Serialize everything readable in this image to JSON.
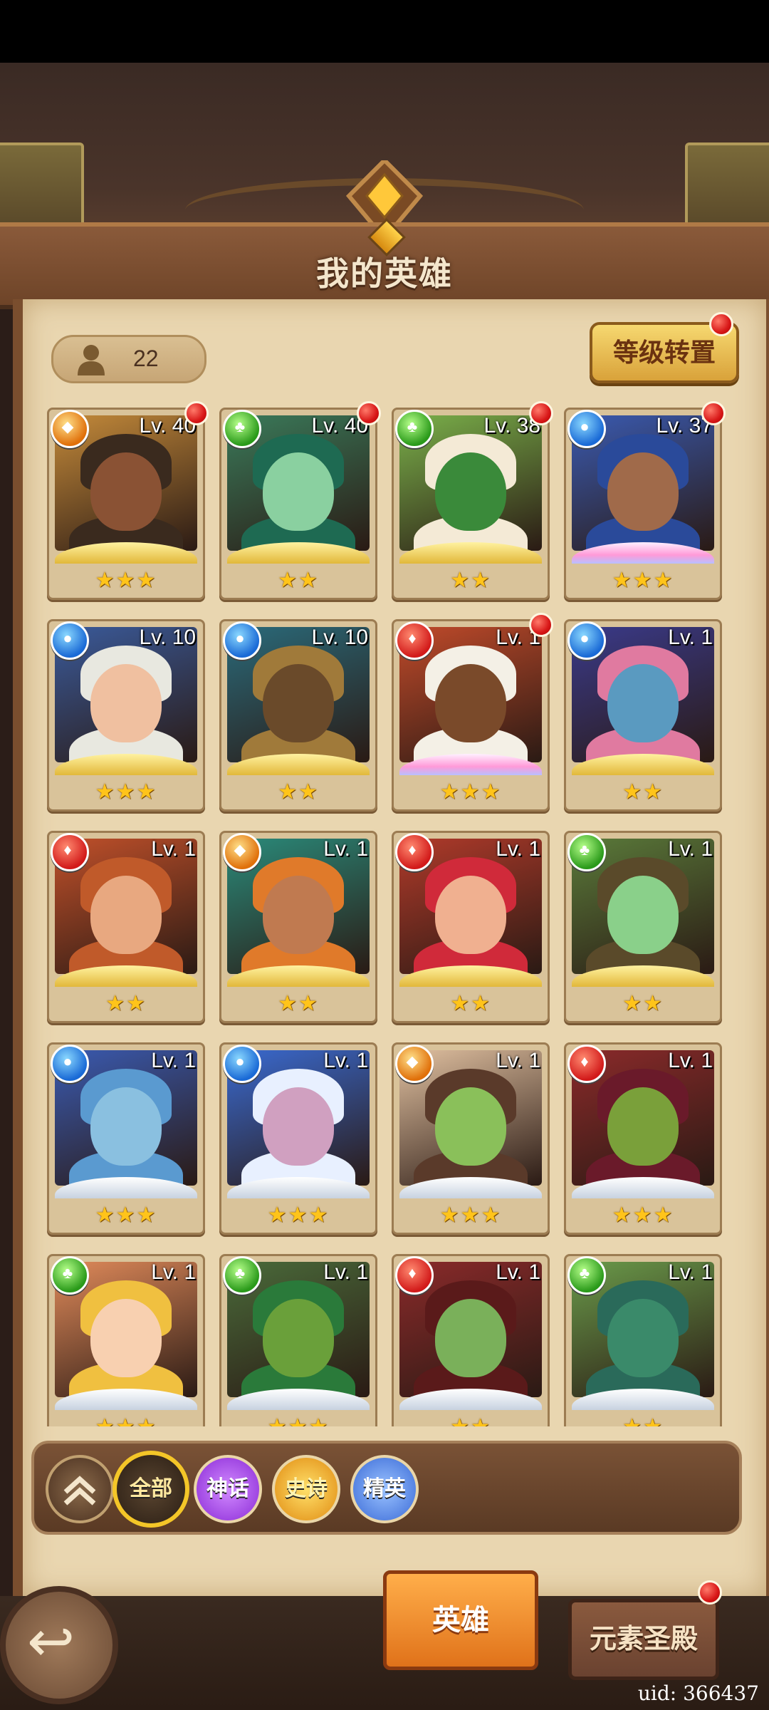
{
  "header": {
    "title": "我的英雄"
  },
  "hero_count": "22",
  "level_transfer_label": "等级转置",
  "filters": {
    "all": "全部",
    "mythic": "神话",
    "epic": "史诗",
    "elite": "精英"
  },
  "bottom_tabs": {
    "heroes": "英雄",
    "element_temple": "元素圣殿"
  },
  "uid": "uid: 366437",
  "heroes": [
    {
      "level": "Lv. 40",
      "element": "light",
      "stars": "★★★",
      "frame": "gold",
      "skin": "#8a5234",
      "hair": "#3a2a1e",
      "bg": "#c48a3a",
      "dot": true
    },
    {
      "level": "Lv. 40",
      "element": "nature",
      "stars": "★★",
      "frame": "gold",
      "skin": "#8ad0a0",
      "hair": "#1e6a52",
      "bg": "#3a7a5a",
      "dot": true
    },
    {
      "level": "Lv. 38",
      "element": "nature",
      "stars": "★★",
      "frame": "gold",
      "skin": "#3a8a3a",
      "hair": "#f4ead6",
      "bg": "#7ab04a",
      "dot": true
    },
    {
      "level": "Lv. 37",
      "element": "water",
      "stars": "★★★",
      "frame": "pink",
      "skin": "#a06a4a",
      "hair": "#2a4a9a",
      "bg": "#3a5ab0",
      "dot": true
    },
    {
      "level": "Lv. 10",
      "element": "water",
      "stars": "★★★",
      "frame": "gold",
      "skin": "#f0c0a0",
      "hair": "#e8e8e0",
      "bg": "#3a5a9a",
      "dot": false
    },
    {
      "level": "Lv. 10",
      "element": "water",
      "stars": "★★",
      "frame": "gold",
      "skin": "#6a4a2a",
      "hair": "#a07a3a",
      "bg": "#2a6a7a",
      "dot": false
    },
    {
      "level": "Lv. 1",
      "element": "fire",
      "stars": "★★★",
      "frame": "pink",
      "skin": "#7a4a2a",
      "hair": "#f4f0e6",
      "bg": "#c04a2a",
      "dot": true
    },
    {
      "level": "Lv. 1",
      "element": "water",
      "stars": "★★",
      "frame": "gold",
      "skin": "#5a9ac0",
      "hair": "#e07aa0",
      "bg": "#3a3a8a",
      "dot": false
    },
    {
      "level": "Lv. 1",
      "element": "fire",
      "stars": "★★",
      "frame": "gold",
      "skin": "#e8a880",
      "hair": "#c05a2a",
      "bg": "#c0502a",
      "dot": false
    },
    {
      "level": "Lv. 1",
      "element": "light",
      "stars": "★★",
      "frame": "gold",
      "skin": "#c07a50",
      "hair": "#e07a2a",
      "bg": "#2a8a7a",
      "dot": false
    },
    {
      "level": "Lv. 1",
      "element": "fire",
      "stars": "★★",
      "frame": "gold",
      "skin": "#f0b090",
      "hair": "#d02a3a",
      "bg": "#b03a2a",
      "dot": false
    },
    {
      "level": "Lv. 1",
      "element": "nature",
      "stars": "★★",
      "frame": "gold",
      "skin": "#8ad08a",
      "hair": "#5a4a2a",
      "bg": "#5a7a3a",
      "dot": false
    },
    {
      "level": "Lv. 1",
      "element": "water",
      "stars": "★★★",
      "frame": "silver",
      "skin": "#8ac0e0",
      "hair": "#5a9ad0",
      "bg": "#3a5ab0",
      "dot": false
    },
    {
      "level": "Lv. 1",
      "element": "water",
      "stars": "★★★",
      "frame": "silver",
      "skin": "#d0a0c0",
      "hair": "#e8f0ff",
      "bg": "#3a6ad0",
      "dot": false
    },
    {
      "level": "Lv. 1",
      "element": "light",
      "stars": "★★★",
      "frame": "silver",
      "skin": "#8ac05a",
      "hair": "#5a3a2a",
      "bg": "#e0c0a0",
      "dot": false
    },
    {
      "level": "Lv. 1",
      "element": "fire",
      "stars": "★★★",
      "frame": "silver",
      "skin": "#7aa03a",
      "hair": "#6a1a2a",
      "bg": "#8a2a2a",
      "dot": false
    },
    {
      "level": "Lv. 1",
      "element": "nature",
      "stars": "★★★",
      "frame": "silver",
      "skin": "#f8d0b0",
      "hair": "#f0c040",
      "bg": "#e08a5a",
      "dot": false
    },
    {
      "level": "Lv. 1",
      "element": "nature",
      "stars": "★★★",
      "frame": "silver",
      "skin": "#6aa03a",
      "hair": "#2a7a3a",
      "bg": "#4a6a3a",
      "dot": false
    },
    {
      "level": "Lv. 1",
      "element": "fire",
      "stars": "★★",
      "frame": "silver",
      "skin": "#7ab05a",
      "hair": "#5a1a1a",
      "bg": "#8a2a2a",
      "dot": false
    },
    {
      "level": "Lv. 1",
      "element": "nature",
      "stars": "★★",
      "frame": "silver",
      "skin": "#3a8a6a",
      "hair": "#2a6a5a",
      "bg": "#6a9a4a",
      "dot": false
    }
  ],
  "colors": {
    "parchment": "#e9d6b0",
    "accent_gold": "#f4c628",
    "tab_active": "#e0721a",
    "notification": "#d81818"
  }
}
